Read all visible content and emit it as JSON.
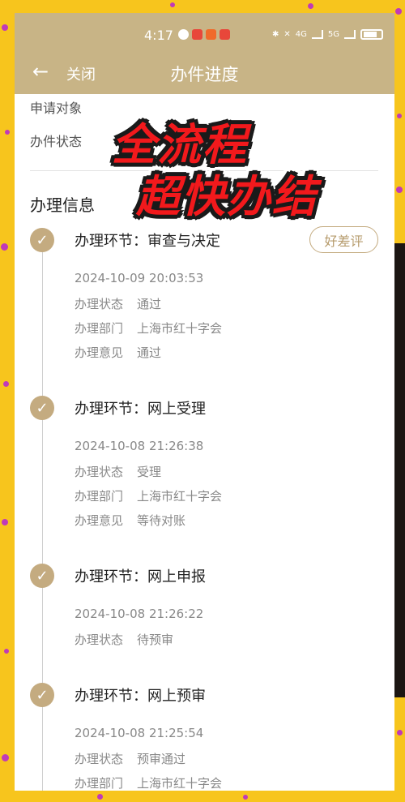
{
  "status_bar": {
    "time": "4:17",
    "network_4g": "4G",
    "network_5g": "5G"
  },
  "nav": {
    "back_icon": "arrow-left-icon",
    "close_label": "关闭",
    "title": "办件进度"
  },
  "basic_info": {
    "applicant_label": "申请对象",
    "status_label": "办件状态"
  },
  "promo": {
    "line1": "全流程",
    "line2": "超快办结"
  },
  "section_title": "办理信息",
  "review_button": "好差评",
  "steps": [
    {
      "title": "办理环节：审查与决定",
      "time": "2024-10-09 20:03:53",
      "rows": [
        {
          "key": "办理状态",
          "value": "通过"
        },
        {
          "key": "办理部门",
          "value": "上海市红十字会"
        },
        {
          "key": "办理意见",
          "value": "通过"
        }
      ]
    },
    {
      "title": "办理环节：网上受理",
      "time": "2024-10-08 21:26:38",
      "rows": [
        {
          "key": "办理状态",
          "value": "受理"
        },
        {
          "key": "办理部门",
          "value": "上海市红十字会"
        },
        {
          "key": "办理意见",
          "value": "等待对账"
        }
      ]
    },
    {
      "title": "办理环节：网上申报",
      "time": "2024-10-08 21:26:22",
      "rows": [
        {
          "key": "办理状态",
          "value": "待预审"
        }
      ]
    },
    {
      "title": "办理环节：网上预审",
      "time": "2024-10-08 21:25:54",
      "rows": [
        {
          "key": "办理状态",
          "value": "预审通过"
        },
        {
          "key": "办理部门",
          "value": "上海市红十字会"
        }
      ]
    }
  ],
  "colors": {
    "header": "#c8b486",
    "accent": "#c4ab80",
    "frame": "#f7c51d",
    "promo_red": "#f2191c"
  }
}
